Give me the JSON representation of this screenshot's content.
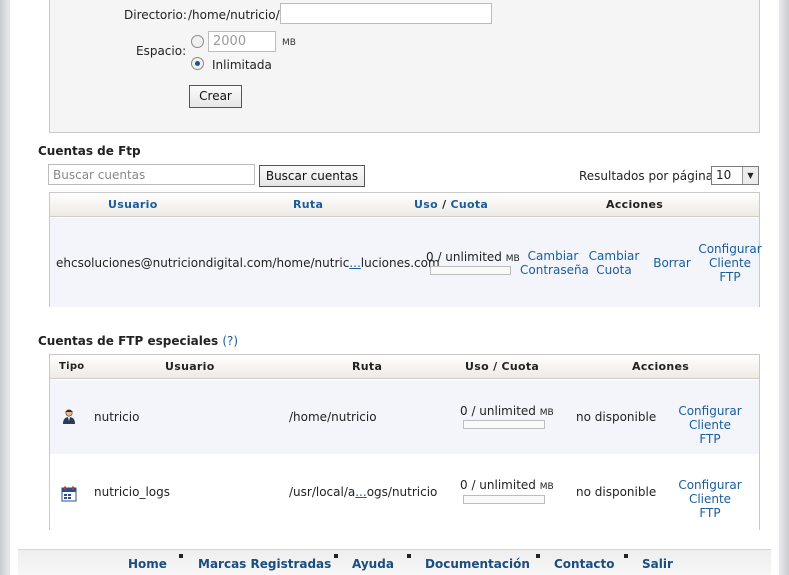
{
  "create_form": {
    "directory_label": "Directorio:",
    "directory_prefix": "/home/nutricio/",
    "directory_value": "",
    "space_label": "Espacio:",
    "quota_value": "2000",
    "quota_unit": "MB",
    "unlimited_label": "Inlimitada",
    "create_button": "Crear"
  },
  "ftp_accounts": {
    "title": "Cuentas de Ftp",
    "search_placeholder": "Buscar cuentas",
    "search_button": "Buscar cuentas",
    "results_label": "Resultados por página:",
    "results_value": "10",
    "headers": {
      "user": "Usuario",
      "path": "Ruta",
      "usage": "Uso",
      "slash": " / ",
      "quota": "Cuota",
      "actions": "Acciones"
    },
    "rows": [
      {
        "account_prefix": "ehcsoluciones@nutriciondigital.com/home/nutric",
        "account_ellipsis": "...",
        "account_suffix": "luciones.com",
        "usage": "0 / unlimited",
        "usage_unit": "MB",
        "change_password": "Cambiar Contraseña",
        "change_quota": "Cambiar Cuota",
        "delete": "Borrar",
        "configure": "Configurar Cliente FTP"
      }
    ]
  },
  "special_accounts": {
    "title": "Cuentas de FTP especiales",
    "help": "(?)",
    "headers": {
      "type": "Tipo",
      "user": "Usuario",
      "path": "Ruta",
      "usage_quota": "Uso / Cuota",
      "actions": "Acciones"
    },
    "rows": [
      {
        "icon": "user-icon",
        "user": "nutricio",
        "path_prefix": "/home/nutricio",
        "path_ellipsis": "",
        "path_suffix": "",
        "usage": "0 / unlimited",
        "usage_unit": "MB",
        "status": "no disponible",
        "configure": "Configurar Cliente FTP"
      },
      {
        "icon": "logs-calendar-icon",
        "user": "nutricio_logs",
        "path_prefix": "/usr/local/a",
        "path_ellipsis": "...",
        "path_suffix": "ogs/nutricio",
        "usage": "0 / unlimited",
        "usage_unit": "MB",
        "status": "no disponible",
        "configure": "Configurar Cliente FTP"
      }
    ]
  },
  "footer": {
    "links": [
      "Home",
      "Marcas Registradas",
      "Ayuda",
      "Documentación",
      "Contacto",
      "Salir"
    ]
  }
}
